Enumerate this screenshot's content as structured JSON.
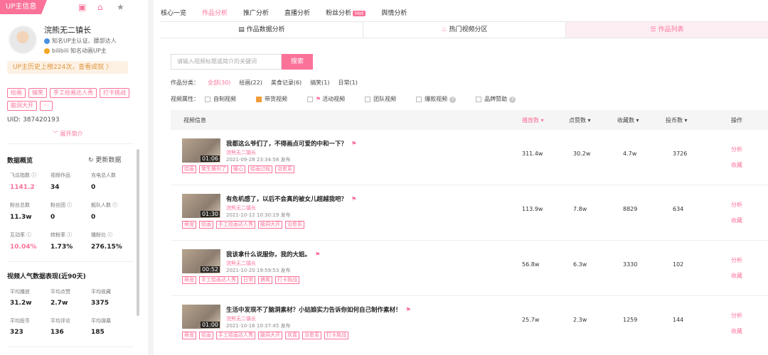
{
  "left": {
    "up_info_tab": "UP主信息",
    "username": "浣熊无二镇长",
    "badges": [
      "知名UP主认证、腰部达人",
      "bilibili 知名动画UP主"
    ],
    "history": "UP主历史上榜224次，查看成就 〉",
    "tags": [
      "绘画",
      "搞笑",
      "手工绘画达人秀",
      "打卡挑战",
      "脑洞大开",
      "···"
    ],
    "uid": "UID: 387420193",
    "expand": "﹀ 展开简介",
    "overview_title": "数据概览",
    "refresh": "更新数据",
    "stats": [
      {
        "label": "飞瓜指数 ⓘ",
        "value": "1141.2"
      },
      {
        "label": "视频作品",
        "value": "34"
      },
      {
        "label": "充电总人数",
        "value": "0"
      },
      {
        "label": "粉丝总数",
        "value": "11.3w"
      },
      {
        "label": "粉丝团 ⓘ",
        "value": "0"
      },
      {
        "label": "舰队人数 ⓘ",
        "value": "0"
      },
      {
        "label": "互动率 ⓘ",
        "value": "10.04%"
      },
      {
        "label": "转粉率 ⓘ",
        "value": "1.73%"
      },
      {
        "label": "播粉比 ⓘ",
        "value": "276.15%"
      }
    ],
    "popularity_title": "视频人气数据表现(近90天)",
    "pop_stats": [
      {
        "label": "平均播放",
        "value": "31.2w"
      },
      {
        "label": "平均点赞",
        "value": "2.7w"
      },
      {
        "label": "平均收藏",
        "value": "3375"
      },
      {
        "label": "平均投币",
        "value": "323"
      },
      {
        "label": "平均评论",
        "value": "136"
      },
      {
        "label": "平均弹幕",
        "value": "185"
      }
    ]
  },
  "nav": [
    "核心一览",
    "作品分析",
    "推广分析",
    "直播分析",
    "粉丝分析",
    "舆情分析"
  ],
  "nav_hot": "Hot",
  "subtabs": [
    "作品数据分析",
    "热门视频分区",
    "作品列表"
  ],
  "search": {
    "placeholder": "请输入视频标题或简介的关键词",
    "button": "搜索"
  },
  "category_label": "作品分类：",
  "categories": [
    "全部(30)",
    "绘画(22)",
    "美食记录(6)",
    "搞笑(1)",
    "日常(1)"
  ],
  "attribute_label": "视频属性：",
  "attributes": [
    "自制视频",
    "带货视频",
    "活动视频",
    "团队视频",
    "爆款视频",
    "品牌赞助"
  ],
  "columns": [
    "视频信息",
    "播放数 ▾",
    "点赞数 ▾",
    "收藏数 ▾",
    "投币数 ▾",
    "操作"
  ],
  "ops": [
    "分析",
    "收藏"
  ],
  "rows": [
    {
      "title": "我都这么爷们了，不得画点可爱的中和一下？",
      "author": "浣熊无二镇长",
      "date": "2021-09-28 23:34:58 发布",
      "duration": "01:06",
      "tags": [
        "绘画",
        "笑生横列了",
        "暖心",
        "绘画过程",
        "治愈系"
      ],
      "plays": "311.4w",
      "likes": "30.2w",
      "favs": "4.7w",
      "coins": "3726"
    },
    {
      "title": "有危机感了，以后不会真的被女儿超越我吧？",
      "author": "浣熊无二镇长",
      "date": "2021-10-12 10:30:19 发布",
      "duration": "01:30",
      "tags": [
        "萌宠",
        "绘画",
        "手工绘画达人秀",
        "脑洞大开",
        "治愈系"
      ],
      "plays": "113.9w",
      "likes": "7.8w",
      "favs": "8829",
      "coins": "634"
    },
    {
      "title": "我该拿什么说服你，我的大姐。",
      "author": "浣熊无二镇长",
      "date": "2021-10-20 19:59:53 发布",
      "duration": "00:52",
      "tags": [
        "萌宠",
        "手工绘画达人秀",
        "日常",
        "搞笑",
        "打卡挑战"
      ],
      "plays": "56.8w",
      "likes": "6.3w",
      "favs": "3330",
      "coins": "102"
    },
    {
      "title": "生活中发现不了脑洞素材？小姑娘实力告诉你如何自己制作素材！",
      "author": "浣熊无二镇长",
      "date": "2021-10-16 10:37:45 发布",
      "duration": "01:00",
      "tags": [
        "萌宠",
        "绘画",
        "手工绘画达人秀",
        "脑洞大开",
        "欢喜",
        "治愈系",
        "打卡挑战"
      ],
      "plays": "25.7w",
      "likes": "2.3w",
      "favs": "1259",
      "coins": "144"
    }
  ]
}
